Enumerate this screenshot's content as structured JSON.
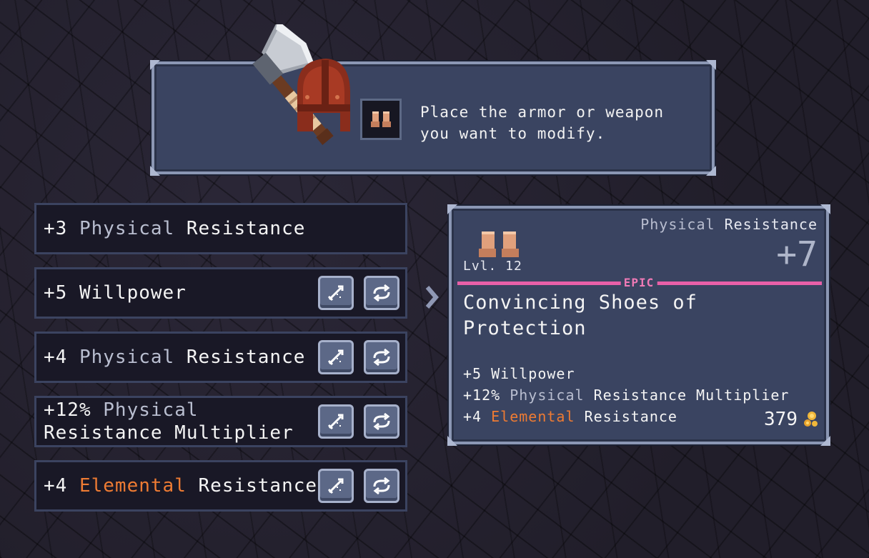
{
  "instruction": {
    "text": "Place the armor or weapon\nyou want to modify."
  },
  "stat_rows": [
    {
      "prefix": "+3",
      "grey": "Physical",
      "orange": "",
      "suffix": "Resistance",
      "has_buttons": false
    },
    {
      "prefix": "+5",
      "grey": "",
      "orange": "",
      "suffix": "Willpower",
      "has_buttons": true
    },
    {
      "prefix": "+4",
      "grey": "Physical",
      "orange": "",
      "suffix": "Resistance",
      "has_buttons": true
    },
    {
      "prefix": "+12%",
      "grey": "Physical",
      "orange": "",
      "suffix": "Resistance Multiplier",
      "has_buttons": true
    },
    {
      "prefix": "+4",
      "grey": "",
      "orange": "Elemental",
      "suffix": "Resistance",
      "has_buttons": true
    }
  ],
  "result": {
    "stat_label_grey": "Physical",
    "stat_label": "Resistance",
    "bonus": "+7",
    "level": "Lvl. 12",
    "rarity": "EPIC",
    "item_name": "Convincing Shoes of Protection",
    "stats": [
      {
        "prefix": "+5",
        "grey": "",
        "orange": "",
        "suffix": "Willpower"
      },
      {
        "prefix": "+12%",
        "grey": "Physical",
        "orange": "",
        "suffix": "Resistance Multiplier"
      },
      {
        "prefix": "+4",
        "grey": "",
        "orange": "Elemental",
        "suffix": "Resistance"
      }
    ],
    "gold": "379"
  },
  "colors": {
    "rarity_epic": "#e860a8",
    "elemental": "#ee7b33",
    "physical": "#b9bed0"
  },
  "icons": {
    "lock_button": "sword-lock-icon",
    "reroll_button": "reroll-arrows-icon"
  }
}
